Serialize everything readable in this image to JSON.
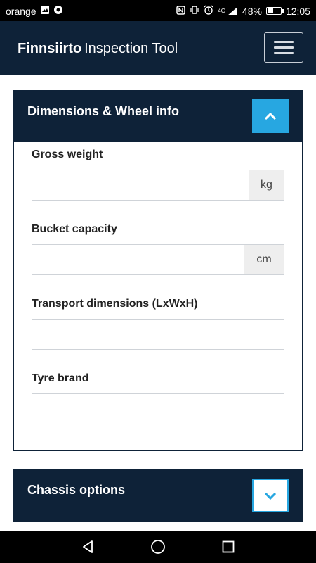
{
  "status_bar": {
    "carrier": "orange",
    "network": "4G",
    "battery": "48%",
    "battery_level": 0.48,
    "time": "12:05"
  },
  "header": {
    "brand_bold": "Finnsiirto",
    "brand_rest": "Inspection Tool",
    "menu_icon": "hamburger-icon"
  },
  "panel": {
    "title": "Dimensions & Wheel info",
    "toggle_icon": "chevron-up-icon",
    "fields": [
      {
        "label": "Gross weight",
        "value": "",
        "unit": "kg"
      },
      {
        "label": "Bucket capacity",
        "value": "",
        "unit": "cm"
      },
      {
        "label": "Transport dimensions (LxWxH)",
        "value": ""
      },
      {
        "label": "Tyre brand",
        "value": ""
      }
    ]
  },
  "panel2": {
    "title": "Chassis options",
    "toggle_icon": "chevron-down-icon"
  },
  "colors": {
    "navy": "#0e2238",
    "accent": "#27a7e1",
    "addon_bg": "#eeeeee"
  }
}
